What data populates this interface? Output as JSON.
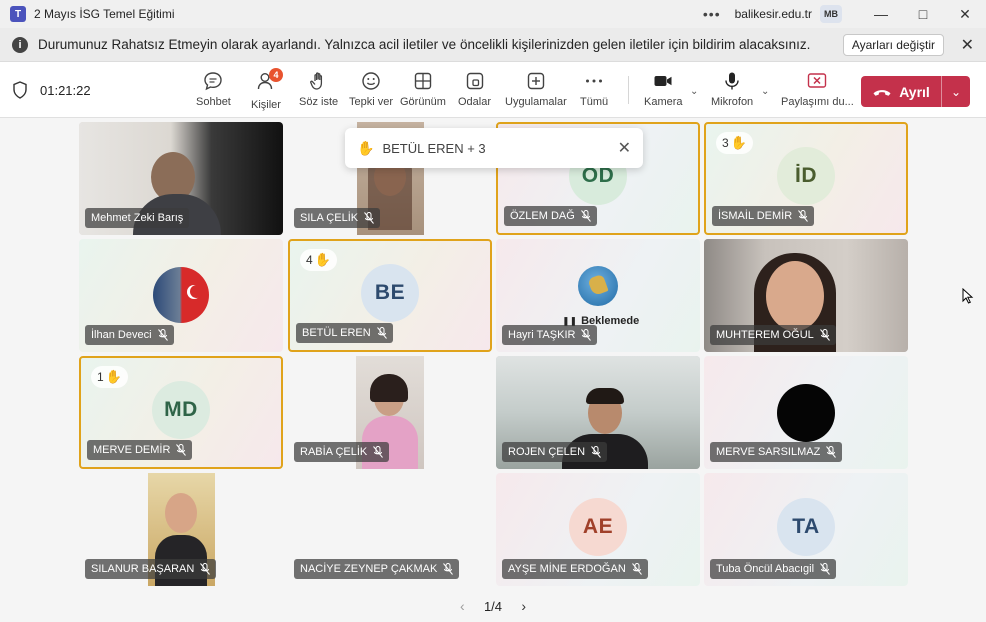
{
  "window": {
    "title": "2 Mayıs İSG Temel Eğitimi",
    "org": "balikesir.edu.tr",
    "avatar": "MB",
    "dots": "•••"
  },
  "banner": {
    "text": "Durumunuz Rahatsız Etmeyin olarak ayarlandı. Yalnızca acil iletiler ve öncelikli kişilerinizden gelen iletiler için bildirim alacaksınız.",
    "button": "Ayarları değiştir"
  },
  "toolbar": {
    "timer": "01:21:22",
    "people_badge": "4",
    "items": [
      "Sohbet",
      "Kişiler",
      "Söz iste",
      "Tepki ver",
      "Görünüm",
      "Odalar",
      "Uygulamalar",
      "Tümü",
      "Kamera",
      "Mikrofon",
      "Paylaşımı du..."
    ],
    "leave": "Ayrıl"
  },
  "toast": {
    "text": "BETÜL EREN + 3"
  },
  "participants": [
    {
      "name": "Mehmet Zeki Barış"
    },
    {
      "name": "SILA ÇELİK"
    },
    {
      "name": "ÖZLEM DAĞ",
      "initials": "ÖD"
    },
    {
      "name": "İSMAİL DEMİR",
      "initials": "İD",
      "hand": "3"
    },
    {
      "name": "İlhan Deveci"
    },
    {
      "name": "BETÜL EREN",
      "initials": "BE",
      "hand": "4"
    },
    {
      "name": "Hayri TAŞKIR",
      "status": "Beklemede"
    },
    {
      "name": "MUHTEREM OĞUL"
    },
    {
      "name": "MERVE DEMİR",
      "initials": "MD",
      "hand": "1"
    },
    {
      "name": "RABİA ÇELİK"
    },
    {
      "name": "ROJEN ÇELEN"
    },
    {
      "name": "MERVE SARSILMAZ"
    },
    {
      "name": "SILANUR BAŞARAN"
    },
    {
      "name": "NACİYE ZEYNEP ÇAKMAK"
    },
    {
      "name": "AYŞE MİNE ERDOĞAN",
      "initials": "AE"
    },
    {
      "name": "Tuba Öncül Abacıgil",
      "initials": "TA"
    }
  ],
  "pager": {
    "text": "1/4"
  },
  "colors": {
    "accent": "#4b53bc",
    "leave": "#c4314b",
    "speaking": "#e0a31b",
    "badge": "#e8532f"
  }
}
